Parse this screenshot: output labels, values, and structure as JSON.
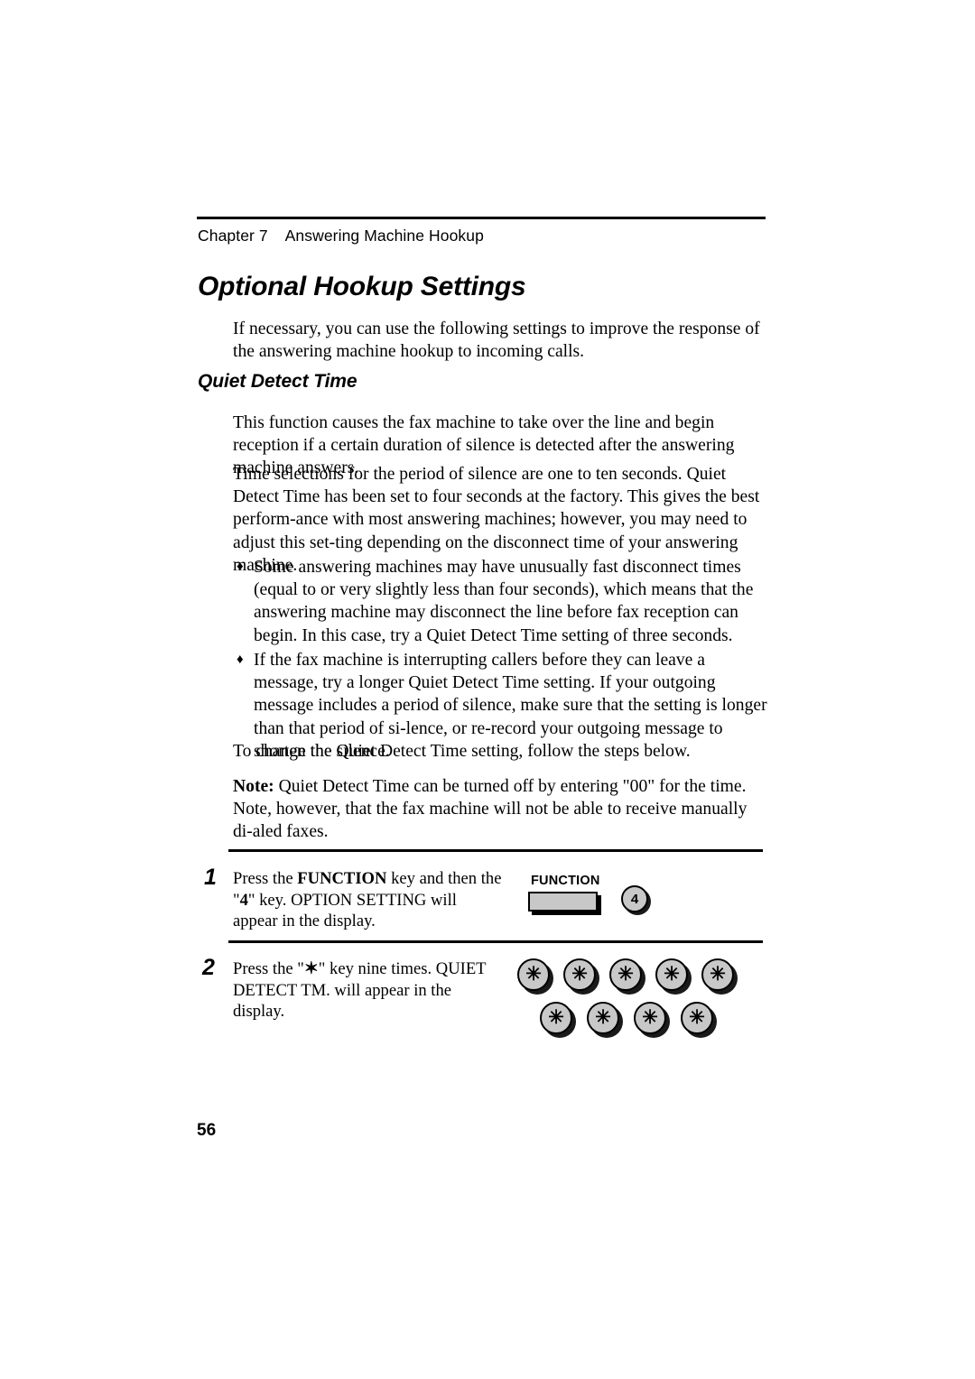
{
  "document": {
    "running_head": {
      "chapter_label": "Chapter 7",
      "chapter_title": "Answering Machine Hookup",
      "combined": "Chapter 7    Answering Machine Hookup"
    },
    "title": "Optional Hookup Settings",
    "intro_paragraph": "If necessary, you can use the following settings to improve the response of the answering machine hookup to incoming calls.",
    "section": {
      "heading": "Quiet Detect Time",
      "paragraphs": [
        "This function causes the fax machine to take over the line and begin reception if a certain duration of silence is detected after the answering machine answers.",
        "Time selections for the period of silence are one to ten seconds. Quiet Detect Time has been set to four seconds at the factory. This gives the best perform-ance with most answering machines; however, you may need to adjust this set-ting depending on the disconnect time of your answering machine."
      ],
      "bullets": [
        {
          "marker": "♦",
          "text": "Some answering machines may have unusually fast disconnect times (equal to or very slightly less than four seconds), which means that the answering machine may disconnect the line before fax reception can begin. In this case, try a Quiet Detect Time setting of three seconds."
        },
        {
          "marker": "♦",
          "text": "If the fax machine is interrupting callers before they can leave a message, try a longer Quiet Detect Time setting. If your outgoing message includes a period of silence, make sure that the setting is longer than that period of si-lence, or re-record your outgoing message to shorten the silence."
        }
      ],
      "closing_paragraph": "To change the Quiet Detect Time setting, follow the steps below.",
      "note": {
        "label": "Note:",
        "text": " Quiet Detect Time can be turned off by entering \"00\" for the time. Note, however, that the fax machine will not be able to receive manually di-aled faxes."
      }
    },
    "steps": [
      {
        "number": "1",
        "text_parts": {
          "before_function": "Press the ",
          "function_key": "FUNCTION",
          "middle": " key and then the \"",
          "number_key": "4",
          "after": "\" key. OPTION SETTING will appear in the display."
        },
        "keys": {
          "function_label": "FUNCTION",
          "number_key_label": "4"
        }
      },
      {
        "number": "2",
        "text_parts": {
          "before": "Press the \"",
          "star": "✶",
          "after": "\" key nine times. QUIET DETECT TM. will appear in the display."
        },
        "star_keys": {
          "glyph": "✳",
          "top_row_count": 5,
          "bottom_row_count": 4,
          "total": 9
        }
      }
    ],
    "page_number": "56",
    "colors": {
      "text": "#000000",
      "page_background": "#ffffff",
      "key_fill": "#c8c8c8",
      "key_outline": "#000000",
      "key_shadow": "#1a1a1a"
    }
  }
}
